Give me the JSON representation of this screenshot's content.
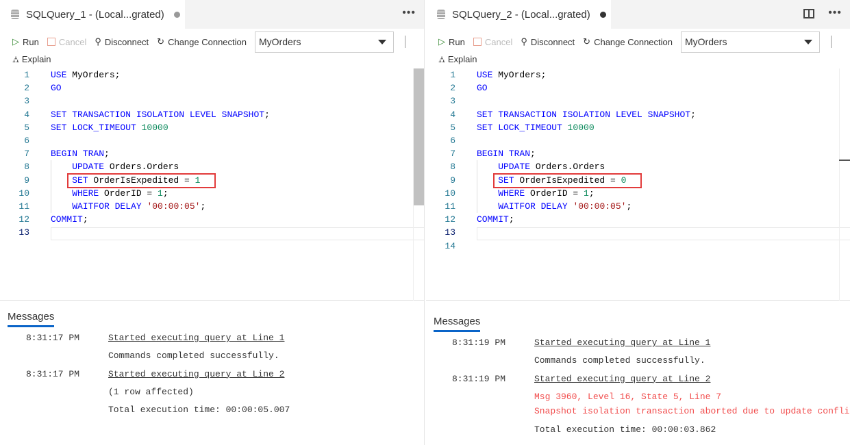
{
  "panes": [
    {
      "tab_title": "SQLQuery_1 - (Local...grated)",
      "dirty_color": "#999999",
      "toolbar": {
        "run": "Run",
        "cancel": "Cancel",
        "disconnect": "Disconnect",
        "change_connection": "Change Connection",
        "database": "MyOrders",
        "explain": "Explain"
      },
      "code": [
        [
          [
            "USE",
            "k"
          ],
          [
            " MyOrders;",
            "p"
          ]
        ],
        [
          [
            "GO",
            "k"
          ]
        ],
        [],
        [
          [
            "SET TRANSACTION ISOLATION LEVEL SNAPSHOT",
            "k"
          ],
          [
            ";",
            "p"
          ]
        ],
        [
          [
            "SET LOCK_TIMEOUT ",
            "k"
          ],
          [
            "10000",
            "n"
          ]
        ],
        [],
        [
          [
            "BEGIN TRAN",
            "k"
          ],
          [
            ";",
            "p"
          ]
        ],
        [
          [
            "    UPDATE",
            "k"
          ],
          [
            " Orders.Orders",
            "p"
          ]
        ],
        [
          [
            "    SET",
            "k"
          ],
          [
            " OrderIsExpedited = ",
            "p"
          ],
          [
            "1",
            "n"
          ]
        ],
        [
          [
            "    WHERE",
            "k"
          ],
          [
            " OrderID = ",
            "p"
          ],
          [
            "1",
            "n"
          ],
          [
            ";",
            "p"
          ]
        ],
        [
          [
            "    WAITFOR DELAY ",
            "k"
          ],
          [
            "'00:00:05'",
            "s"
          ],
          [
            ";",
            "p"
          ]
        ],
        [
          [
            "COMMIT",
            "k"
          ],
          [
            ";",
            "p"
          ]
        ],
        []
      ],
      "messages_title": "Messages",
      "messages": [
        {
          "time": "8:31:17 PM",
          "text": "Started executing query at Line 1",
          "type": "link"
        },
        {
          "time": "",
          "text": "Commands completed successfully.",
          "type": "plain"
        },
        {
          "time": "8:31:17 PM",
          "text": "Started executing query at Line 2",
          "type": "link"
        },
        {
          "time": "",
          "text": "(1 row affected)",
          "type": "plain"
        },
        {
          "time": "",
          "text": "Total execution time: 00:00:05.007",
          "type": "plain"
        }
      ]
    },
    {
      "tab_title": "SQLQuery_2 - (Local...grated)",
      "dirty_color": "#333333",
      "toolbar": {
        "run": "Run",
        "cancel": "Cancel",
        "disconnect": "Disconnect",
        "change_connection": "Change Connection",
        "database": "MyOrders",
        "explain": "Explain"
      },
      "code": [
        [
          [
            "USE",
            "k"
          ],
          [
            " MyOrders;",
            "p"
          ]
        ],
        [
          [
            "GO",
            "k"
          ]
        ],
        [],
        [
          [
            "SET TRANSACTION ISOLATION LEVEL SNAPSHOT",
            "k"
          ],
          [
            ";",
            "p"
          ]
        ],
        [
          [
            "SET LOCK_TIMEOUT ",
            "k"
          ],
          [
            "10000",
            "n"
          ]
        ],
        [],
        [
          [
            "BEGIN TRAN",
            "k"
          ],
          [
            ";",
            "p"
          ]
        ],
        [
          [
            "    UPDATE",
            "k"
          ],
          [
            " Orders.Orders",
            "p"
          ]
        ],
        [
          [
            "    SET",
            "k"
          ],
          [
            " OrderIsExpedited = ",
            "p"
          ],
          [
            "0",
            "n"
          ]
        ],
        [
          [
            "    WHERE",
            "k"
          ],
          [
            " OrderID = ",
            "p"
          ],
          [
            "1",
            "n"
          ],
          [
            ";",
            "p"
          ]
        ],
        [
          [
            "    WAITFOR DELAY ",
            "k"
          ],
          [
            "'00:00:05'",
            "s"
          ],
          [
            ";",
            "p"
          ]
        ],
        [
          [
            "COMMIT",
            "k"
          ],
          [
            ";",
            "p"
          ]
        ],
        [],
        []
      ],
      "messages_title": "Messages",
      "messages": [
        {
          "time": "8:31:19 PM",
          "text": "Started executing query at Line 1",
          "type": "link"
        },
        {
          "time": "",
          "text": "Commands completed successfully.",
          "type": "plain"
        },
        {
          "time": "8:31:19 PM",
          "text": "Started executing query at Line 2",
          "type": "link"
        },
        {
          "time": "",
          "text": "Msg 3960, Level 16, State 5, Line 7",
          "type": "error"
        },
        {
          "time": "",
          "text": "Snapshot isolation transaction aborted due to update confli",
          "type": "error"
        },
        {
          "time": "",
          "text": "Total execution time: 00:00:03.862",
          "type": "plain"
        }
      ]
    }
  ]
}
